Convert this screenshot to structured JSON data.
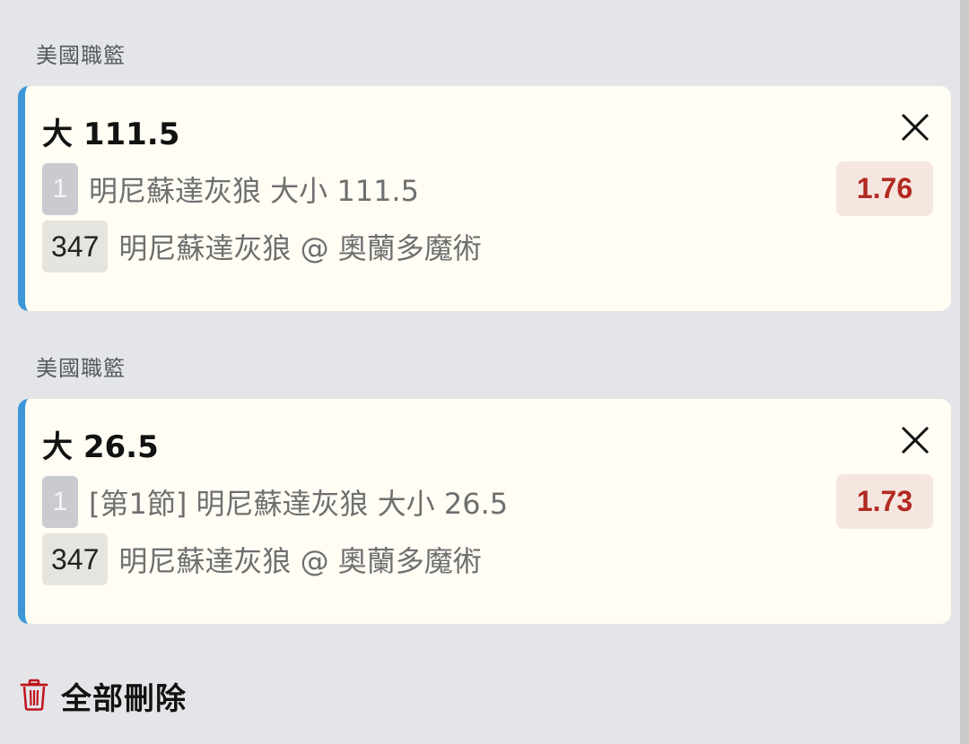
{
  "bets": [
    {
      "league": "美國職籃",
      "title": "大 111.5",
      "badge_num": "1",
      "market": "明尼蘇達灰狼 大小 111.5",
      "game_code": "347",
      "matchup": "明尼蘇達灰狼 @ 奧蘭多魔術",
      "odds": "1.76"
    },
    {
      "league": "美國職籃",
      "title": "大 26.5",
      "badge_num": "1",
      "market": "[第1節] 明尼蘇達灰狼 大小 26.5",
      "game_code": "347",
      "matchup": "明尼蘇達灰狼 @ 奧蘭多魔術",
      "odds": "1.73"
    }
  ],
  "footer": {
    "delete_all_label": "全部刪除",
    "delete_icon": "trash-icon"
  },
  "colors": {
    "accent": "#3c97d9",
    "odds_text": "#b22a22",
    "odds_bg": "#f6e6e0",
    "card_bg": "#fffdf4",
    "page_bg": "#e4e5e8"
  }
}
